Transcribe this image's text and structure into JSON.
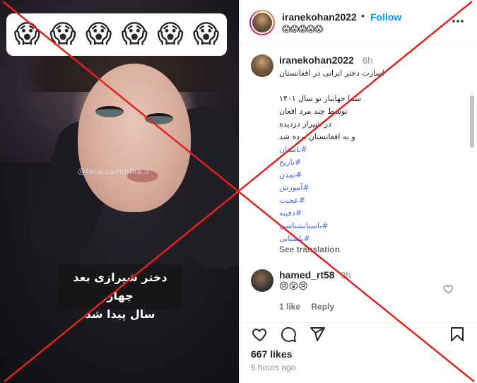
{
  "media": {
    "overlay_emojis": [
      "😱",
      "😱",
      "😱",
      "😱",
      "😱",
      "😱"
    ],
    "watermark": "@fara.zaminiha.ir",
    "caption_line1": "دختر شیرازی بعد چهار",
    "caption_line2": "سال پیدا شد"
  },
  "header": {
    "username": "iranekohan2022",
    "separator": "•",
    "follow_label": "Follow",
    "subtitle": "😱😱😱😱😱",
    "more_icon": "more-horizontal-icon"
  },
  "caption_comment": {
    "username": "iranekohan2022",
    "time": "6h",
    "lines": [
      "اسارت دختر ایرانی در افغانستان",
      "",
      "سما جهانباز تو سال ۱۴۰۱",
      "توسط چند مرد افغان",
      "در شیراز دزدیده",
      "و به افغانستان برده شد"
    ],
    "hashtags": [
      "#باستان",
      "#تاریخ",
      "#تمدن",
      "#آموزش",
      "#عجیب",
      "#دفینه",
      "#باستانشناسی",
      "#باستانی"
    ],
    "see_translation": "See translation"
  },
  "comment2": {
    "username": "hamed_rt58",
    "time": "3h",
    "emojis": "😢😮😢",
    "like_label": "1 like",
    "reply_label": "Reply"
  },
  "actions": {
    "icons": [
      "heart-icon",
      "comment-icon",
      "share-icon",
      "bookmark-icon"
    ],
    "likes": "667 likes",
    "posted": "6 hours ago"
  },
  "colors": {
    "accent": "#0095f6",
    "overlay_x": "#e0231c",
    "hashtag": "#4a68c9"
  }
}
